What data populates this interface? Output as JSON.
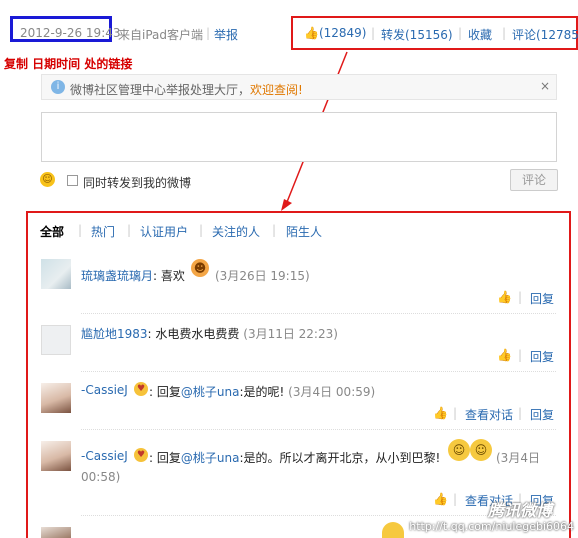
{
  "meta": {
    "date": "2012-9-26 19:43",
    "source": "来自iPad客户端",
    "report_label": "举报"
  },
  "actions": {
    "like": "(12849)",
    "forward": "转发(15156)",
    "favorite": "收藏",
    "comment": "评论(12785"
  },
  "annotation": "复制 日期时间 处的链接",
  "notice": {
    "text": "微博社区管理中心举报处理大厅，",
    "link": "欢迎查阅!",
    "close": "×"
  },
  "composer": {
    "forward_label": "同时转发到我的微博",
    "submit_label": "评论"
  },
  "filters": [
    "全部",
    "热门",
    "认证用户",
    "关注的人",
    "陌生人"
  ],
  "comments": [
    {
      "user": "琉璃盏琉璃月",
      "colon": ":",
      "text": "喜欢",
      "time": "(3月26日 19:15)",
      "reply_label": "回复"
    },
    {
      "user": "尴尬地1983",
      "colon": ":",
      "text": "水电费水电费费",
      "time": "(3月11日 22:23)",
      "reply_label": "回复"
    },
    {
      "user": "-CassieJ",
      "colon": ":",
      "text_prefix": "回复",
      "mention": "@桃子una",
      "text": ":是的呢!",
      "time": "(3月4日 00:59)",
      "view_label": "查看对话",
      "reply_label": "回复"
    },
    {
      "user": "-CassieJ",
      "colon": ":",
      "text_prefix": "回复",
      "mention": "@桃子una",
      "text": ":是的。所以才离开北京，从小到巴黎!",
      "time_line1": "(3月4日",
      "time_line2": "00:58)",
      "view_label": "查看对话",
      "reply_label": "回复"
    }
  ],
  "watermark": {
    "logo": "腾讯微博",
    "url": "http://t.qq.com/niulegebi6064"
  },
  "colors": {
    "date_box": "#1a1ad6",
    "highlight_box": "#e01919",
    "link": "#2a6ab0",
    "notice_link": "#e07800"
  }
}
